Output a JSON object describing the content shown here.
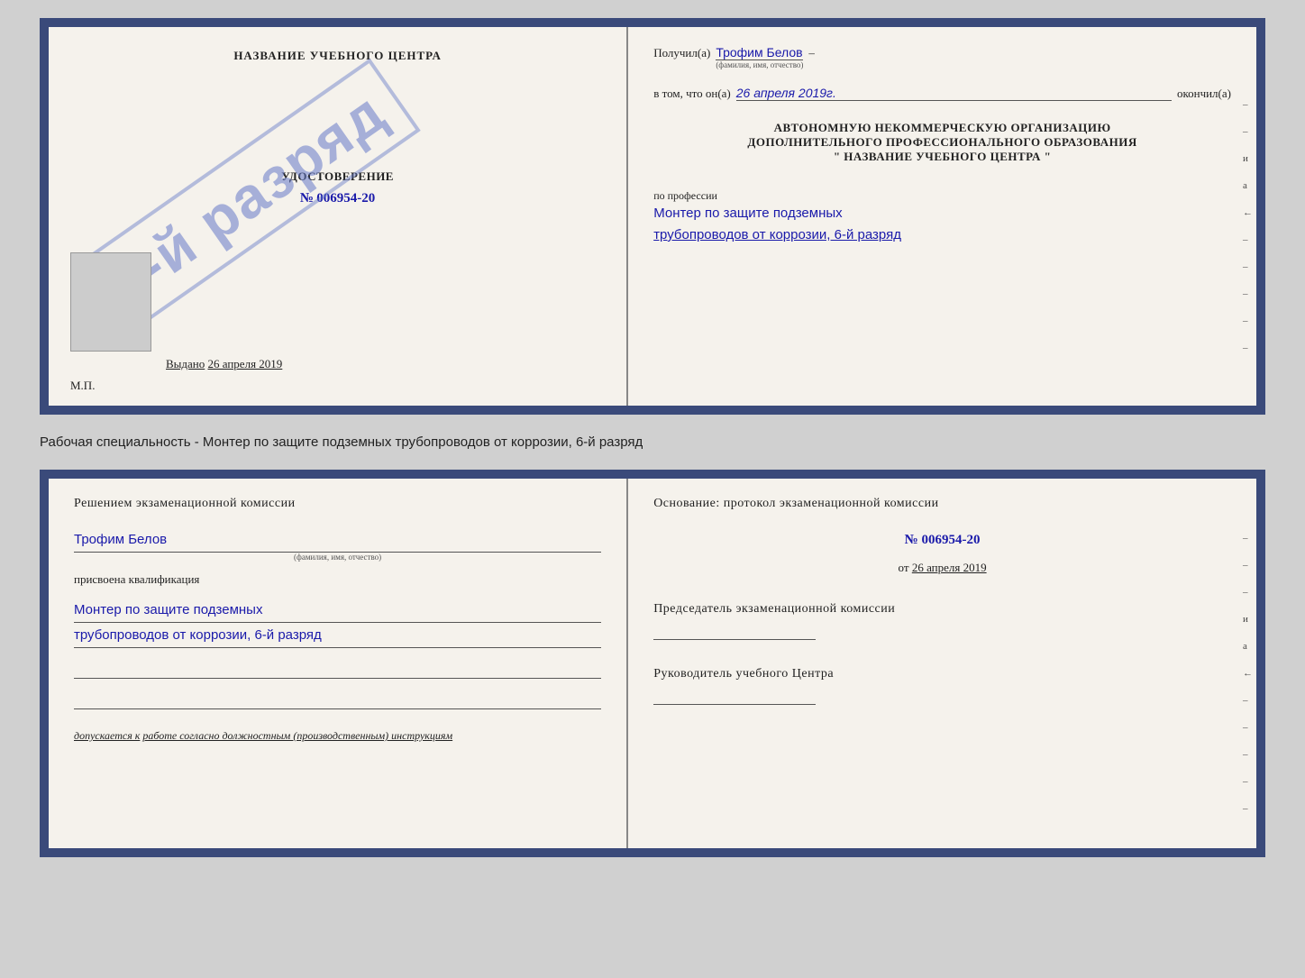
{
  "top_cert": {
    "left": {
      "title": "НАЗВАНИЕ УЧЕБНОГО ЦЕНТРА",
      "cert_label": "УДОСТОВЕРЕНИЕ",
      "cert_number_prefix": "№",
      "cert_number": "006954-20",
      "stamp_text": "6-й разряд",
      "issued_prefix": "Выдано",
      "issued_date": "26 апреля 2019",
      "mp_label": "М.П."
    },
    "right": {
      "received_prefix": "Получил(а)",
      "received_name": "Трофим Белов",
      "name_sub": "(фамилия, имя, отчество)",
      "dash": "–",
      "in_that_prefix": "в том, что он(а)",
      "in_that_date": "26 апреля 2019г.",
      "finished": "окончил(а)",
      "org_line1": "АВТОНОМНУЮ НЕКОММЕРЧЕСКУЮ ОРГАНИЗАЦИЮ",
      "org_line2": "ДОПОЛНИТЕЛЬНОГО ПРОФЕССИОНАЛЬНОГО ОБРАЗОВАНИЯ",
      "org_name": "\" НАЗВАНИЕ УЧЕБНОГО ЦЕНТРА \"",
      "profession_prefix": "по профессии",
      "profession_line1": "Монтер по защите подземных",
      "profession_line2": "трубопроводов от коррозии, 6-й разряд",
      "right_letters": [
        "–",
        "–",
        "и",
        "а",
        "←",
        "–",
        "–",
        "–",
        "–",
        "–"
      ]
    }
  },
  "specialty_label": {
    "text": "Рабочая специальность - Монтер по защите подземных трубопроводов от коррозии, 6-й разряд"
  },
  "bottom_cert": {
    "left": {
      "decision_title": "Решением экзаменационной комиссии",
      "person_name": "Трофим Белов",
      "name_sub": "(фамилия, имя, отчество)",
      "assigned_label": "присвоена квалификация",
      "qualification_line1": "Монтер по защите подземных",
      "qualification_line2": "трубопроводов от коррозии, 6-й разряд",
      "допускается_prefix": "допускается к",
      "допускается_value": "работе согласно должностным (производственным) инструкциям"
    },
    "right": {
      "basis_title": "Основание: протокол экзаменационной комиссии",
      "number_prefix": "№",
      "number": "006954-20",
      "date_prefix": "от",
      "date": "26 апреля 2019",
      "chair_title": "Председатель экзаменационной комиссии",
      "director_title": "Руководитель учебного Центра",
      "right_letters": [
        "–",
        "–",
        "–",
        "и",
        "а",
        "←",
        "–",
        "–",
        "–",
        "–",
        "–"
      ]
    }
  }
}
